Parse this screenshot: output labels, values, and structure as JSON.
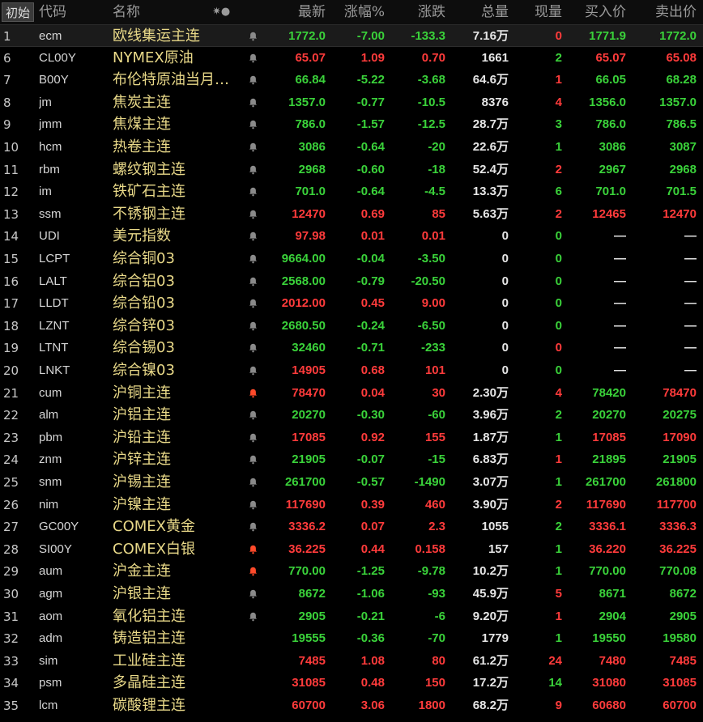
{
  "header": {
    "init_label": "初始",
    "cols": [
      "代码",
      "名称",
      "最新",
      "涨幅%",
      "涨跌",
      "总量",
      "现量",
      "买入价",
      "卖出价"
    ]
  },
  "colors": {
    "up": "#ff3b3b",
    "down": "#3ad23a",
    "name": "#e8d888",
    "bell_active": "#ff4a2a"
  },
  "rows": [
    {
      "idx": "1",
      "code": "ecm",
      "name": "欧线集运主连",
      "last": "1772.0",
      "pct": "-7.00",
      "chg": "-133.3",
      "vol": "7.16万",
      "cur": "0",
      "bid": "1771.9",
      "ask": "1772.0",
      "bell": "gray",
      "sel": true,
      "cls": {
        "last": "dn",
        "pct": "dn",
        "chg": "dn",
        "cur": "up",
        "bid": "dn",
        "ask": "dn"
      }
    },
    {
      "idx": "6",
      "code": "CL00Y",
      "name": "NYMEX原油",
      "last": "65.07",
      "pct": "1.09",
      "chg": "0.70",
      "vol": "1661",
      "cur": "2",
      "bid": "65.07",
      "ask": "65.08",
      "bell": "gray",
      "cls": {
        "last": "up",
        "pct": "up",
        "chg": "up",
        "cur": "dn",
        "bid": "up",
        "ask": "up"
      }
    },
    {
      "idx": "7",
      "code": "B00Y",
      "name": "布伦特原油当月…",
      "last": "66.84",
      "pct": "-5.22",
      "chg": "-3.68",
      "vol": "64.6万",
      "cur": "1",
      "bid": "66.05",
      "ask": "68.28",
      "bell": "gray",
      "cls": {
        "last": "dn",
        "pct": "dn",
        "chg": "dn",
        "cur": "up",
        "bid": "dn",
        "ask": "dn"
      }
    },
    {
      "idx": "8",
      "code": "jm",
      "name": "焦炭主连",
      "last": "1357.0",
      "pct": "-0.77",
      "chg": "-10.5",
      "vol": "8376",
      "cur": "4",
      "bid": "1356.0",
      "ask": "1357.0",
      "bell": "gray",
      "cls": {
        "last": "dn",
        "pct": "dn",
        "chg": "dn",
        "cur": "up",
        "bid": "dn",
        "ask": "dn"
      }
    },
    {
      "idx": "9",
      "code": "jmm",
      "name": "焦煤主连",
      "last": "786.0",
      "pct": "-1.57",
      "chg": "-12.5",
      "vol": "28.7万",
      "cur": "3",
      "bid": "786.0",
      "ask": "786.5",
      "bell": "gray",
      "cls": {
        "last": "dn",
        "pct": "dn",
        "chg": "dn",
        "cur": "dn",
        "bid": "dn",
        "ask": "dn"
      }
    },
    {
      "idx": "10",
      "code": "hcm",
      "name": "热卷主连",
      "last": "3086",
      "pct": "-0.64",
      "chg": "-20",
      "vol": "22.6万",
      "cur": "1",
      "bid": "3086",
      "ask": "3087",
      "bell": "gray",
      "cls": {
        "last": "dn",
        "pct": "dn",
        "chg": "dn",
        "cur": "dn",
        "bid": "dn",
        "ask": "dn"
      }
    },
    {
      "idx": "11",
      "code": "rbm",
      "name": "螺纹钢主连",
      "last": "2968",
      "pct": "-0.60",
      "chg": "-18",
      "vol": "52.4万",
      "cur": "2",
      "bid": "2967",
      "ask": "2968",
      "bell": "gray",
      "cls": {
        "last": "dn",
        "pct": "dn",
        "chg": "dn",
        "cur": "up",
        "bid": "dn",
        "ask": "dn"
      }
    },
    {
      "idx": "12",
      "code": "im",
      "name": "铁矿石主连",
      "last": "701.0",
      "pct": "-0.64",
      "chg": "-4.5",
      "vol": "13.3万",
      "cur": "6",
      "bid": "701.0",
      "ask": "701.5",
      "bell": "gray",
      "cls": {
        "last": "dn",
        "pct": "dn",
        "chg": "dn",
        "cur": "dn",
        "bid": "dn",
        "ask": "dn"
      }
    },
    {
      "idx": "13",
      "code": "ssm",
      "name": "不锈钢主连",
      "last": "12470",
      "pct": "0.69",
      "chg": "85",
      "vol": "5.63万",
      "cur": "2",
      "bid": "12465",
      "ask": "12470",
      "bell": "gray",
      "cls": {
        "last": "up",
        "pct": "up",
        "chg": "up",
        "cur": "up",
        "bid": "up",
        "ask": "up"
      }
    },
    {
      "idx": "14",
      "code": "UDI",
      "name": "美元指数",
      "last": "97.98",
      "pct": "0.01",
      "chg": "0.01",
      "vol": "0",
      "cur": "0",
      "bid": "—",
      "ask": "—",
      "bell": "gray",
      "cls": {
        "last": "up",
        "pct": "up",
        "chg": "up",
        "cur": "dn",
        "bid": "nl",
        "ask": "nl"
      }
    },
    {
      "idx": "15",
      "code": "LCPT",
      "name": "综合铜03",
      "last": "9664.00",
      "pct": "-0.04",
      "chg": "-3.50",
      "vol": "0",
      "cur": "0",
      "bid": "—",
      "ask": "—",
      "bell": "gray",
      "cls": {
        "last": "dn",
        "pct": "dn",
        "chg": "dn",
        "cur": "dn",
        "bid": "nl",
        "ask": "nl"
      }
    },
    {
      "idx": "16",
      "code": "LALT",
      "name": "综合铝03",
      "last": "2568.00",
      "pct": "-0.79",
      "chg": "-20.50",
      "vol": "0",
      "cur": "0",
      "bid": "—",
      "ask": "—",
      "bell": "gray",
      "cls": {
        "last": "dn",
        "pct": "dn",
        "chg": "dn",
        "cur": "dn",
        "bid": "nl",
        "ask": "nl"
      }
    },
    {
      "idx": "17",
      "code": "LLDT",
      "name": "综合铅03",
      "last": "2012.00",
      "pct": "0.45",
      "chg": "9.00",
      "vol": "0",
      "cur": "0",
      "bid": "—",
      "ask": "—",
      "bell": "gray",
      "cls": {
        "last": "up",
        "pct": "up",
        "chg": "up",
        "cur": "dn",
        "bid": "nl",
        "ask": "nl"
      }
    },
    {
      "idx": "18",
      "code": "LZNT",
      "name": "综合锌03",
      "last": "2680.50",
      "pct": "-0.24",
      "chg": "-6.50",
      "vol": "0",
      "cur": "0",
      "bid": "—",
      "ask": "—",
      "bell": "gray",
      "cls": {
        "last": "dn",
        "pct": "dn",
        "chg": "dn",
        "cur": "dn",
        "bid": "nl",
        "ask": "nl"
      }
    },
    {
      "idx": "19",
      "code": "LTNT",
      "name": "综合锡03",
      "last": "32460",
      "pct": "-0.71",
      "chg": "-233",
      "vol": "0",
      "cur": "0",
      "bid": "—",
      "ask": "—",
      "bell": "gray",
      "cls": {
        "last": "dn",
        "pct": "dn",
        "chg": "dn",
        "cur": "up",
        "bid": "nl",
        "ask": "nl"
      }
    },
    {
      "idx": "20",
      "code": "LNKT",
      "name": "综合镍03",
      "last": "14905",
      "pct": "0.68",
      "chg": "101",
      "vol": "0",
      "cur": "0",
      "bid": "—",
      "ask": "—",
      "bell": "gray",
      "cls": {
        "last": "up",
        "pct": "up",
        "chg": "up",
        "cur": "dn",
        "bid": "nl",
        "ask": "nl"
      }
    },
    {
      "idx": "21",
      "code": "cum",
      "name": "沪铜主连",
      "last": "78470",
      "pct": "0.04",
      "chg": "30",
      "vol": "2.30万",
      "cur": "4",
      "bid": "78420",
      "ask": "78470",
      "bell": "red",
      "cls": {
        "last": "up",
        "pct": "up",
        "chg": "up",
        "cur": "up",
        "bid": "dn",
        "ask": "up"
      }
    },
    {
      "idx": "22",
      "code": "alm",
      "name": "沪铝主连",
      "last": "20270",
      "pct": "-0.30",
      "chg": "-60",
      "vol": "3.96万",
      "cur": "2",
      "bid": "20270",
      "ask": "20275",
      "bell": "gray",
      "cls": {
        "last": "dn",
        "pct": "dn",
        "chg": "dn",
        "cur": "dn",
        "bid": "dn",
        "ask": "dn"
      }
    },
    {
      "idx": "23",
      "code": "pbm",
      "name": "沪铅主连",
      "last": "17085",
      "pct": "0.92",
      "chg": "155",
      "vol": "1.87万",
      "cur": "1",
      "bid": "17085",
      "ask": "17090",
      "bell": "gray",
      "cls": {
        "last": "up",
        "pct": "up",
        "chg": "up",
        "cur": "dn",
        "bid": "up",
        "ask": "up"
      }
    },
    {
      "idx": "24",
      "code": "znm",
      "name": "沪锌主连",
      "last": "21905",
      "pct": "-0.07",
      "chg": "-15",
      "vol": "6.83万",
      "cur": "1",
      "bid": "21895",
      "ask": "21905",
      "bell": "gray",
      "cls": {
        "last": "dn",
        "pct": "dn",
        "chg": "dn",
        "cur": "up",
        "bid": "dn",
        "ask": "dn"
      }
    },
    {
      "idx": "25",
      "code": "snm",
      "name": "沪锡主连",
      "last": "261700",
      "pct": "-0.57",
      "chg": "-1490",
      "vol": "3.07万",
      "cur": "1",
      "bid": "261700",
      "ask": "261800",
      "bell": "gray",
      "cls": {
        "last": "dn",
        "pct": "dn",
        "chg": "dn",
        "cur": "dn",
        "bid": "dn",
        "ask": "dn"
      }
    },
    {
      "idx": "26",
      "code": "nim",
      "name": "沪镍主连",
      "last": "117690",
      "pct": "0.39",
      "chg": "460",
      "vol": "3.90万",
      "cur": "2",
      "bid": "117690",
      "ask": "117700",
      "bell": "gray",
      "cls": {
        "last": "up",
        "pct": "up",
        "chg": "up",
        "cur": "up",
        "bid": "up",
        "ask": "up"
      }
    },
    {
      "idx": "27",
      "code": "GC00Y",
      "name": "COMEX黄金",
      "last": "3336.2",
      "pct": "0.07",
      "chg": "2.3",
      "vol": "1055",
      "cur": "2",
      "bid": "3336.1",
      "ask": "3336.3",
      "bell": "gray",
      "cls": {
        "last": "up",
        "pct": "up",
        "chg": "up",
        "cur": "dn",
        "bid": "up",
        "ask": "up"
      }
    },
    {
      "idx": "28",
      "code": "SI00Y",
      "name": "COMEX白银",
      "last": "36.225",
      "pct": "0.44",
      "chg": "0.158",
      "vol": "157",
      "cur": "1",
      "bid": "36.220",
      "ask": "36.225",
      "bell": "red",
      "cls": {
        "last": "up",
        "pct": "up",
        "chg": "up",
        "cur": "dn",
        "bid": "up",
        "ask": "up"
      }
    },
    {
      "idx": "29",
      "code": "aum",
      "name": "沪金主连",
      "last": "770.00",
      "pct": "-1.25",
      "chg": "-9.78",
      "vol": "10.2万",
      "cur": "1",
      "bid": "770.00",
      "ask": "770.08",
      "bell": "red",
      "cls": {
        "last": "dn",
        "pct": "dn",
        "chg": "dn",
        "cur": "dn",
        "bid": "dn",
        "ask": "dn"
      }
    },
    {
      "idx": "30",
      "code": "agm",
      "name": "沪银主连",
      "last": "8672",
      "pct": "-1.06",
      "chg": "-93",
      "vol": "45.9万",
      "cur": "5",
      "bid": "8671",
      "ask": "8672",
      "bell": "gray",
      "cls": {
        "last": "dn",
        "pct": "dn",
        "chg": "dn",
        "cur": "up",
        "bid": "dn",
        "ask": "dn"
      }
    },
    {
      "idx": "31",
      "code": "aom",
      "name": "氧化铝主连",
      "last": "2905",
      "pct": "-0.21",
      "chg": "-6",
      "vol": "9.20万",
      "cur": "1",
      "bid": "2904",
      "ask": "2905",
      "bell": "gray",
      "cls": {
        "last": "dn",
        "pct": "dn",
        "chg": "dn",
        "cur": "up",
        "bid": "dn",
        "ask": "dn"
      }
    },
    {
      "idx": "32",
      "code": "adm",
      "name": "铸造铝主连",
      "last": "19555",
      "pct": "-0.36",
      "chg": "-70",
      "vol": "1779",
      "cur": "1",
      "bid": "19550",
      "ask": "19580",
      "bell": "none",
      "cls": {
        "last": "dn",
        "pct": "dn",
        "chg": "dn",
        "cur": "dn",
        "bid": "dn",
        "ask": "dn"
      }
    },
    {
      "idx": "33",
      "code": "sim",
      "name": "工业硅主连",
      "last": "7485",
      "pct": "1.08",
      "chg": "80",
      "vol": "61.2万",
      "cur": "24",
      "bid": "7480",
      "ask": "7485",
      "bell": "none",
      "cls": {
        "last": "up",
        "pct": "up",
        "chg": "up",
        "cur": "up",
        "bid": "up",
        "ask": "up"
      }
    },
    {
      "idx": "34",
      "code": "psm",
      "name": "多晶硅主连",
      "last": "31085",
      "pct": "0.48",
      "chg": "150",
      "vol": "17.2万",
      "cur": "14",
      "bid": "31080",
      "ask": "31085",
      "bell": "none",
      "cls": {
        "last": "up",
        "pct": "up",
        "chg": "up",
        "cur": "dn",
        "bid": "up",
        "ask": "up"
      }
    },
    {
      "idx": "35",
      "code": "lcm",
      "name": "碳酸锂主连",
      "last": "60700",
      "pct": "3.06",
      "chg": "1800",
      "vol": "68.2万",
      "cur": "9",
      "bid": "60680",
      "ask": "60700",
      "bell": "none",
      "cls": {
        "last": "up",
        "pct": "up",
        "chg": "up",
        "cur": "up",
        "bid": "up",
        "ask": "up"
      }
    }
  ]
}
